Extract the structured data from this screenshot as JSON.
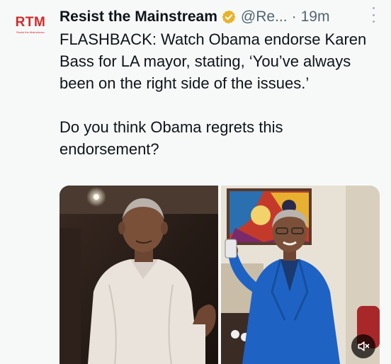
{
  "tweet": {
    "author": {
      "display_name": "Resist the Mainstream",
      "handle": "@Re...",
      "avatar_text": "RTM",
      "avatar_subtext": "Resist the Mainstream",
      "verified_icon": "gold-verified-badge-icon"
    },
    "separator": "·",
    "time": "19m",
    "text_paragraphs": [
      "FLASHBACK: Watch Obama endorse Karen Bass for LA mayor, stating, ‘You’ve always been on the right side of the issues.’",
      "Do you think Obama regrets this endorsement?"
    ],
    "media": {
      "left_image": "man-in-white-shirt-photo",
      "right_image": "woman-in-blue-blazer-photo",
      "mute_icon": "speaker-muted-icon"
    },
    "more_icon": "more-options-icon"
  },
  "colors": {
    "background": "#f7f9f9",
    "text_primary": "#0f1419",
    "text_secondary": "#536471",
    "brand_red": "#d62828",
    "verified_gold": "#e8b32a"
  }
}
